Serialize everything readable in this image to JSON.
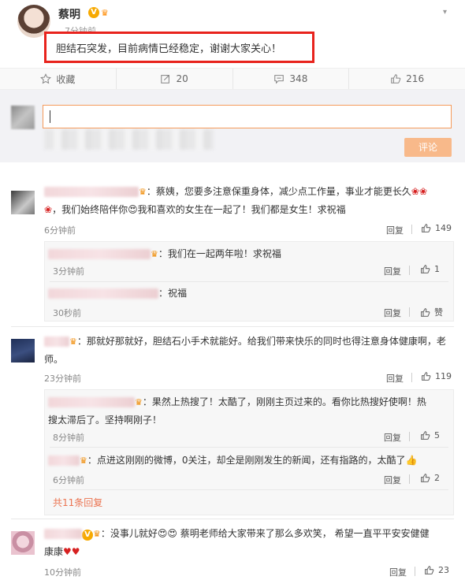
{
  "post": {
    "author": "蔡明",
    "time": "7分钟前",
    "text": "胆结石突发，目前病情已经稳定，谢谢大家关心！",
    "actions": {
      "favorite_label": "收藏",
      "repost_count": "20",
      "comment_count": "348",
      "like_count": "216"
    }
  },
  "compose": {
    "submit_label": "评论"
  },
  "comments": [
    {
      "text_line1": "：蔡姨，您要多注意保重身体，减少点工作量，事业才能更长久",
      "text_line2": "，我们始终陪伴你",
      "text_line2b": "我和喜欢的女生在一起了！我们都是女生！求祝福",
      "time": "6分钟前",
      "reply_label": "回复",
      "likes": "149",
      "replies": [
        {
          "text": "：我们在一起两年啦！求祝福",
          "time": "3分钟前",
          "reply_label": "回复",
          "likes": "1"
        },
        {
          "text": "：祝福",
          "time": "30秒前",
          "reply_label": "回复",
          "likes": "赞"
        }
      ]
    },
    {
      "text_line1": "：那就好那就好，胆结石小手术就能好。给我们带来快乐的同时也得注意身体健康啊，老",
      "text_line2": "师。",
      "time": "23分钟前",
      "reply_label": "回复",
      "likes": "119",
      "replies": [
        {
          "text_line1": "：果然上热搜了！太酷了，刚刚主页过来的。看你比热搜好使啊！热",
          "text_line2": "搜太滞后了。坚持啊刚子！",
          "time": "8分钟前",
          "reply_label": "回复",
          "likes": "5"
        },
        {
          "text": "：点进这刚刚的微博，0关注，却全是刚刚发生的新闻，还有指路的，太酷了",
          "time": "6分钟前",
          "reply_label": "回复",
          "likes": "2"
        }
      ],
      "more_label": "共11条回复"
    },
    {
      "text_line1": "：没事儿就好",
      "text_line1b": "蔡明老师给大家带来了那么多欢笑， 希望一直平平安安健健",
      "text_line2": "康康",
      "time": "10分钟前",
      "reply_label": "回复",
      "likes": "23"
    }
  ]
}
